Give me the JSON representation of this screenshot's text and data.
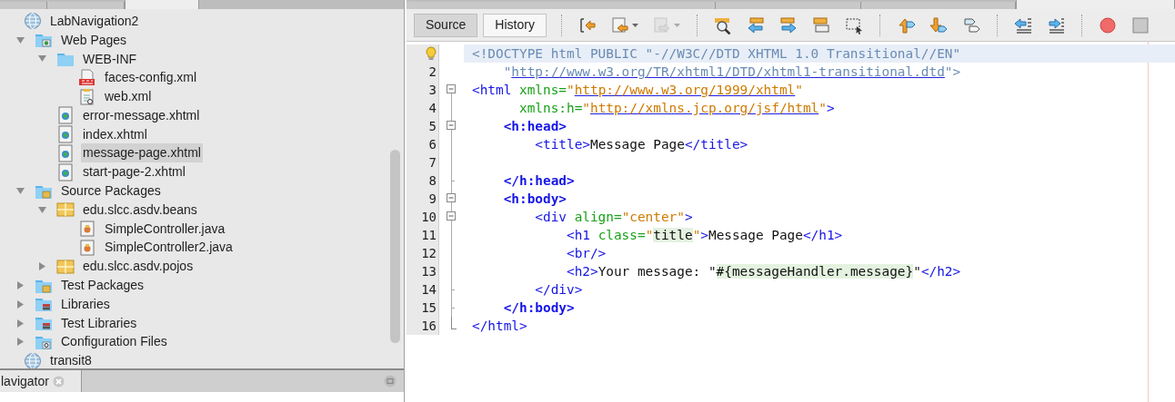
{
  "panel_tabs": [
    {
      "selected": false
    },
    {
      "selected": false
    },
    {
      "selected": true
    }
  ],
  "project_tree": [
    {
      "label": "LabNavigation2",
      "kind": "project",
      "selected": false,
      "children": [
        {
          "label": "Web Pages",
          "kind": "webfolder",
          "expanded": true,
          "selected": false,
          "children": [
            {
              "label": "WEB-INF",
              "kind": "folder",
              "expanded": true,
              "selected": false,
              "children": [
                {
                  "label": "faces-config.xml",
                  "kind": "jsf",
                  "selected": false
                },
                {
                  "label": "web.xml",
                  "kind": "xml",
                  "selected": false
                }
              ]
            },
            {
              "label": "error-message.xhtml",
              "kind": "xhtml",
              "selected": false
            },
            {
              "label": "index.xhtml",
              "kind": "xhtml",
              "selected": false
            },
            {
              "label": "message-page.xhtml",
              "kind": "xhtml",
              "selected": true
            },
            {
              "label": "start-page-2.xhtml",
              "kind": "xhtml",
              "selected": false
            }
          ]
        },
        {
          "label": "Source Packages",
          "kind": "sources",
          "expanded": true,
          "selected": false,
          "children": [
            {
              "label": "edu.slcc.asdv.beans",
              "kind": "package",
              "expanded": true,
              "selected": false,
              "children": [
                {
                  "label": "SimpleController.java",
                  "kind": "java",
                  "selected": false
                },
                {
                  "label": "SimpleController2.java",
                  "kind": "java",
                  "selected": false
                }
              ]
            },
            {
              "label": "edu.slcc.asdv.pojos",
              "kind": "package",
              "expanded": false,
              "selected": false
            }
          ]
        },
        {
          "label": "Test Packages",
          "kind": "sources",
          "expanded": false,
          "selected": false
        },
        {
          "label": "Libraries",
          "kind": "libraries",
          "expanded": false,
          "selected": false
        },
        {
          "label": "Test Libraries",
          "kind": "libraries",
          "expanded": false,
          "selected": false
        },
        {
          "label": "Configuration Files",
          "kind": "config",
          "expanded": false,
          "selected": false
        }
      ]
    },
    {
      "label": "transit8",
      "kind": "project",
      "selected": false
    }
  ],
  "navigator": {
    "tab": "lavigator"
  },
  "editor_tabs": [
    {
      "selected": false
    },
    {
      "selected": false
    },
    {
      "selected": false
    },
    {
      "selected": true
    }
  ],
  "editor": {
    "view_tabs": [
      {
        "label": "Source",
        "selected": true
      },
      {
        "label": "History",
        "selected": false
      }
    ],
    "toolbar_groups": [
      [
        {
          "dropdown": false,
          "disabled": false
        },
        {
          "dropdown": true,
          "disabled": false
        },
        {
          "dropdown": true,
          "disabled": true
        }
      ],
      [
        {
          "dropdown": false,
          "disabled": false
        },
        {
          "dropdown": false,
          "disabled": false
        },
        {
          "dropdown": false,
          "disabled": false
        },
        {
          "dropdown": false,
          "disabled": false
        },
        {
          "dropdown": false,
          "disabled": false
        }
      ],
      [
        {
          "dropdown": false,
          "disabled": false
        },
        {
          "dropdown": false,
          "disabled": false
        },
        {
          "dropdown": false,
          "disabled": false
        }
      ],
      [
        {
          "dropdown": false,
          "disabled": false
        },
        {
          "dropdown": false,
          "disabled": false
        }
      ],
      [
        {
          "dropdown": false,
          "disabled": false
        },
        {
          "dropdown": false,
          "disabled": false
        }
      ]
    ],
    "lines": [
      {
        "hint": true,
        "current": true,
        "segments": [
          {
            "kind": "doctype",
            "text": "<!DOCTYPE html PUBLIC \"-//W3C//DTD XHTML 1.0 Transitional//EN\""
          }
        ]
      },
      {
        "number": "2",
        "hint": false,
        "current": false,
        "segments": [
          {
            "kind": "doctype",
            "text": "    \""
          },
          {
            "kind": "doctype-link",
            "text": "http://www.w3.org/TR/xhtml1/DTD/xhtml1-transitional.dtd"
          },
          {
            "kind": "doctype",
            "text": "\">"
          }
        ]
      },
      {
        "number": "3",
        "hint": false,
        "current": false,
        "segments": [
          {
            "kind": "tag",
            "text": "<html"
          },
          {
            "kind": "attr",
            "text": " xmlns="
          },
          {
            "kind": "value",
            "text": "\""
          },
          {
            "kind": "link",
            "text": "http://www.w3.org/1999/xhtml"
          },
          {
            "kind": "value",
            "text": "\""
          }
        ]
      },
      {
        "number": "4",
        "hint": false,
        "current": false,
        "segments": [
          {
            "kind": "attr",
            "text": "      xmlns:h="
          },
          {
            "kind": "value",
            "text": "\""
          },
          {
            "kind": "link",
            "text": "http://xmlns.jcp.org/jsf/html"
          },
          {
            "kind": "value",
            "text": "\""
          },
          {
            "kind": "tag",
            "text": ">"
          }
        ]
      },
      {
        "number": "5",
        "hint": false,
        "current": false,
        "segments": [
          {
            "kind": "tag-bold",
            "text": "    <h:head>"
          }
        ]
      },
      {
        "number": "6",
        "hint": false,
        "current": false,
        "segments": [
          {
            "kind": "tag",
            "text": "        <title>"
          },
          {
            "kind": "text",
            "text": "Message Page"
          },
          {
            "kind": "tag",
            "text": "</title>"
          }
        ]
      },
      {
        "number": "7",
        "hint": false,
        "current": false
      },
      {
        "number": "8",
        "hint": false,
        "current": false,
        "segments": [
          {
            "kind": "tag-bold",
            "text": "    </h:head>"
          }
        ]
      },
      {
        "number": "9",
        "hint": false,
        "current": false,
        "segments": [
          {
            "kind": "tag-bold",
            "text": "    <h:body>"
          }
        ]
      },
      {
        "number": "10",
        "hint": false,
        "current": false,
        "segments": [
          {
            "kind": "tag",
            "text": "        <div"
          },
          {
            "kind": "attr",
            "text": " align="
          },
          {
            "kind": "value",
            "text": "\"center\""
          },
          {
            "kind": "tag",
            "text": ">"
          }
        ]
      },
      {
        "number": "11",
        "hint": false,
        "current": false,
        "segments": [
          {
            "kind": "tag",
            "text": "            <h1"
          },
          {
            "kind": "attr",
            "text": " class="
          },
          {
            "kind": "value",
            "text": "\""
          },
          {
            "kind": "marked",
            "text": "title"
          },
          {
            "kind": "value",
            "text": "\""
          },
          {
            "kind": "tag",
            "text": ">"
          },
          {
            "kind": "text",
            "text": "Message Page"
          },
          {
            "kind": "tag",
            "text": "</h1>"
          }
        ]
      },
      {
        "number": "12",
        "hint": false,
        "current": false,
        "segments": [
          {
            "kind": "tag",
            "text": "            <br/>"
          }
        ]
      },
      {
        "number": "13",
        "hint": false,
        "current": false,
        "segments": [
          {
            "kind": "tag",
            "text": "            <h2>"
          },
          {
            "kind": "text",
            "text": "Your message: \""
          },
          {
            "kind": "marked",
            "text": "#{messageHandler.message}"
          },
          {
            "kind": "text",
            "text": "\""
          },
          {
            "kind": "tag",
            "text": "</h2>"
          }
        ]
      },
      {
        "number": "14",
        "hint": false,
        "current": false,
        "segments": [
          {
            "kind": "tag",
            "text": "        </div>"
          }
        ]
      },
      {
        "number": "15",
        "hint": false,
        "current": false,
        "segments": [
          {
            "kind": "tag-bold",
            "text": "    </h:body>"
          }
        ]
      },
      {
        "number": "16",
        "hint": false,
        "current": false,
        "segments": [
          {
            "kind": "tag",
            "text": "</html>"
          }
        ]
      }
    ]
  }
}
